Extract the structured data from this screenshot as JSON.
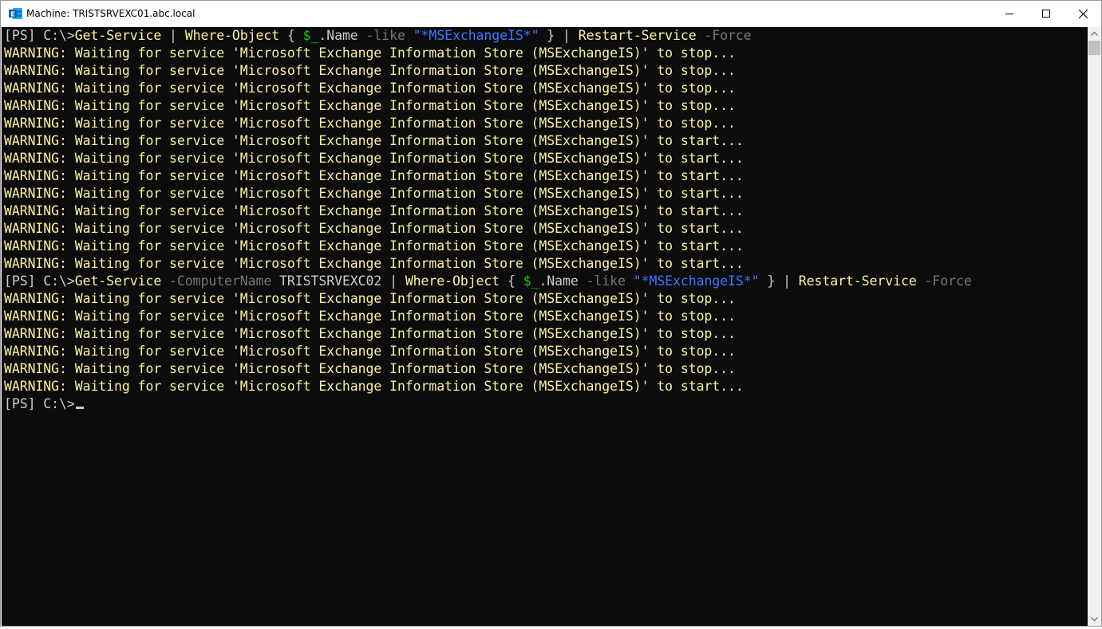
{
  "window": {
    "title": "Machine: TRISTSRVEXC01.abc.local",
    "app_icon": "exchange-management-shell-icon",
    "controls": [
      "minimize-icon",
      "maximize-icon",
      "close-icon"
    ]
  },
  "colors": {
    "console_bg": "#0c0c0c",
    "default_text": "#cccccc",
    "command": "#f9f1a5",
    "parameter": "#767676",
    "string": "#3b78ff",
    "variable": "#16c60c",
    "warning": "#f9f1a5"
  },
  "console": {
    "lines": [
      {
        "kind": "cmd",
        "segments": [
          {
            "t": "[PS] C:\\>",
            "c": "def"
          },
          {
            "t": "Get-Service",
            "c": "cmd"
          },
          {
            "t": " | ",
            "c": "def"
          },
          {
            "t": "Where-Object",
            "c": "cmd"
          },
          {
            "t": " { ",
            "c": "def"
          },
          {
            "t": "$_",
            "c": "var"
          },
          {
            "t": ".Name ",
            "c": "def"
          },
          {
            "t": "-like",
            "c": "par"
          },
          {
            "t": " ",
            "c": "def"
          },
          {
            "t": "\"*MSExchangeIS*\"",
            "c": "str"
          },
          {
            "t": " } | ",
            "c": "def"
          },
          {
            "t": "Restart-Service",
            "c": "cmd"
          },
          {
            "t": " ",
            "c": "def"
          },
          {
            "t": "-Force",
            "c": "par"
          }
        ]
      },
      {
        "kind": "warn",
        "text": "WARNING: Waiting for service 'Microsoft Exchange Information Store (MSExchangeIS)' to stop..."
      },
      {
        "kind": "warn",
        "text": "WARNING: Waiting for service 'Microsoft Exchange Information Store (MSExchangeIS)' to stop..."
      },
      {
        "kind": "warn",
        "text": "WARNING: Waiting for service 'Microsoft Exchange Information Store (MSExchangeIS)' to stop..."
      },
      {
        "kind": "warn",
        "text": "WARNING: Waiting for service 'Microsoft Exchange Information Store (MSExchangeIS)' to stop..."
      },
      {
        "kind": "warn",
        "text": "WARNING: Waiting for service 'Microsoft Exchange Information Store (MSExchangeIS)' to stop..."
      },
      {
        "kind": "warn",
        "text": "WARNING: Waiting for service 'Microsoft Exchange Information Store (MSExchangeIS)' to start..."
      },
      {
        "kind": "warn",
        "text": "WARNING: Waiting for service 'Microsoft Exchange Information Store (MSExchangeIS)' to start..."
      },
      {
        "kind": "warn",
        "text": "WARNING: Waiting for service 'Microsoft Exchange Information Store (MSExchangeIS)' to start..."
      },
      {
        "kind": "warn",
        "text": "WARNING: Waiting for service 'Microsoft Exchange Information Store (MSExchangeIS)' to start..."
      },
      {
        "kind": "warn",
        "text": "WARNING: Waiting for service 'Microsoft Exchange Information Store (MSExchangeIS)' to start..."
      },
      {
        "kind": "warn",
        "text": "WARNING: Waiting for service 'Microsoft Exchange Information Store (MSExchangeIS)' to start..."
      },
      {
        "kind": "warn",
        "text": "WARNING: Waiting for service 'Microsoft Exchange Information Store (MSExchangeIS)' to start..."
      },
      {
        "kind": "warn",
        "text": "WARNING: Waiting for service 'Microsoft Exchange Information Store (MSExchangeIS)' to start..."
      },
      {
        "kind": "cmd",
        "segments": [
          {
            "t": "[PS] C:\\>",
            "c": "def"
          },
          {
            "t": "Get-Service",
            "c": "cmd"
          },
          {
            "t": " ",
            "c": "def"
          },
          {
            "t": "-ComputerName",
            "c": "par"
          },
          {
            "t": " TRISTSRVEXC02 | ",
            "c": "def"
          },
          {
            "t": "Where-Object",
            "c": "cmd"
          },
          {
            "t": " { ",
            "c": "def"
          },
          {
            "t": "$_",
            "c": "var"
          },
          {
            "t": ".Name ",
            "c": "def"
          },
          {
            "t": "-like",
            "c": "par"
          },
          {
            "t": " ",
            "c": "def"
          },
          {
            "t": "\"*MSExchangeIS*\"",
            "c": "str"
          },
          {
            "t": " } | ",
            "c": "def"
          },
          {
            "t": "Restart-Service",
            "c": "cmd"
          },
          {
            "t": " ",
            "c": "def"
          },
          {
            "t": "-Force",
            "c": "par"
          }
        ]
      },
      {
        "kind": "warn",
        "text": "WARNING: Waiting for service 'Microsoft Exchange Information Store (MSExchangeIS)' to stop..."
      },
      {
        "kind": "warn",
        "text": "WARNING: Waiting for service 'Microsoft Exchange Information Store (MSExchangeIS)' to stop..."
      },
      {
        "kind": "warn",
        "text": "WARNING: Waiting for service 'Microsoft Exchange Information Store (MSExchangeIS)' to stop..."
      },
      {
        "kind": "warn",
        "text": "WARNING: Waiting for service 'Microsoft Exchange Information Store (MSExchangeIS)' to stop..."
      },
      {
        "kind": "warn",
        "text": "WARNING: Waiting for service 'Microsoft Exchange Information Store (MSExchangeIS)' to stop..."
      },
      {
        "kind": "warn",
        "text": "WARNING: Waiting for service 'Microsoft Exchange Information Store (MSExchangeIS)' to start..."
      },
      {
        "kind": "prompt",
        "text": "[PS] C:\\>"
      }
    ]
  }
}
